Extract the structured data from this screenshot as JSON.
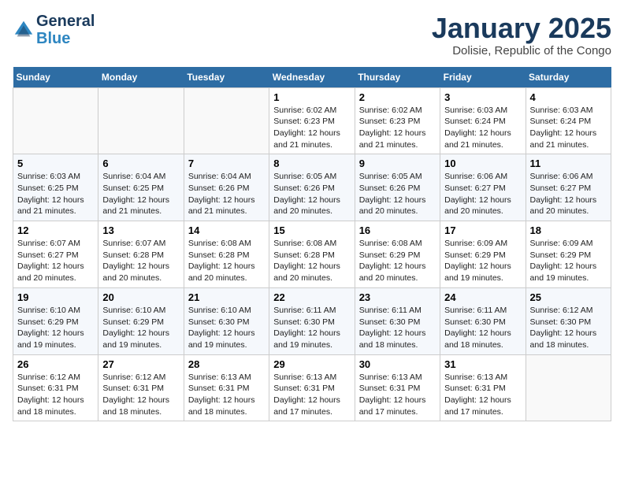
{
  "logo": {
    "line1": "General",
    "line2": "Blue"
  },
  "title": "January 2025",
  "location": "Dolisie, Republic of the Congo",
  "weekdays": [
    "Sunday",
    "Monday",
    "Tuesday",
    "Wednesday",
    "Thursday",
    "Friday",
    "Saturday"
  ],
  "weeks": [
    [
      {
        "day": "",
        "info": ""
      },
      {
        "day": "",
        "info": ""
      },
      {
        "day": "",
        "info": ""
      },
      {
        "day": "1",
        "info": "Sunrise: 6:02 AM\nSunset: 6:23 PM\nDaylight: 12 hours\nand 21 minutes."
      },
      {
        "day": "2",
        "info": "Sunrise: 6:02 AM\nSunset: 6:23 PM\nDaylight: 12 hours\nand 21 minutes."
      },
      {
        "day": "3",
        "info": "Sunrise: 6:03 AM\nSunset: 6:24 PM\nDaylight: 12 hours\nand 21 minutes."
      },
      {
        "day": "4",
        "info": "Sunrise: 6:03 AM\nSunset: 6:24 PM\nDaylight: 12 hours\nand 21 minutes."
      }
    ],
    [
      {
        "day": "5",
        "info": "Sunrise: 6:03 AM\nSunset: 6:25 PM\nDaylight: 12 hours\nand 21 minutes."
      },
      {
        "day": "6",
        "info": "Sunrise: 6:04 AM\nSunset: 6:25 PM\nDaylight: 12 hours\nand 21 minutes."
      },
      {
        "day": "7",
        "info": "Sunrise: 6:04 AM\nSunset: 6:26 PM\nDaylight: 12 hours\nand 21 minutes."
      },
      {
        "day": "8",
        "info": "Sunrise: 6:05 AM\nSunset: 6:26 PM\nDaylight: 12 hours\nand 20 minutes."
      },
      {
        "day": "9",
        "info": "Sunrise: 6:05 AM\nSunset: 6:26 PM\nDaylight: 12 hours\nand 20 minutes."
      },
      {
        "day": "10",
        "info": "Sunrise: 6:06 AM\nSunset: 6:27 PM\nDaylight: 12 hours\nand 20 minutes."
      },
      {
        "day": "11",
        "info": "Sunrise: 6:06 AM\nSunset: 6:27 PM\nDaylight: 12 hours\nand 20 minutes."
      }
    ],
    [
      {
        "day": "12",
        "info": "Sunrise: 6:07 AM\nSunset: 6:27 PM\nDaylight: 12 hours\nand 20 minutes."
      },
      {
        "day": "13",
        "info": "Sunrise: 6:07 AM\nSunset: 6:28 PM\nDaylight: 12 hours\nand 20 minutes."
      },
      {
        "day": "14",
        "info": "Sunrise: 6:08 AM\nSunset: 6:28 PM\nDaylight: 12 hours\nand 20 minutes."
      },
      {
        "day": "15",
        "info": "Sunrise: 6:08 AM\nSunset: 6:28 PM\nDaylight: 12 hours\nand 20 minutes."
      },
      {
        "day": "16",
        "info": "Sunrise: 6:08 AM\nSunset: 6:29 PM\nDaylight: 12 hours\nand 20 minutes."
      },
      {
        "day": "17",
        "info": "Sunrise: 6:09 AM\nSunset: 6:29 PM\nDaylight: 12 hours\nand 19 minutes."
      },
      {
        "day": "18",
        "info": "Sunrise: 6:09 AM\nSunset: 6:29 PM\nDaylight: 12 hours\nand 19 minutes."
      }
    ],
    [
      {
        "day": "19",
        "info": "Sunrise: 6:10 AM\nSunset: 6:29 PM\nDaylight: 12 hours\nand 19 minutes."
      },
      {
        "day": "20",
        "info": "Sunrise: 6:10 AM\nSunset: 6:29 PM\nDaylight: 12 hours\nand 19 minutes."
      },
      {
        "day": "21",
        "info": "Sunrise: 6:10 AM\nSunset: 6:30 PM\nDaylight: 12 hours\nand 19 minutes."
      },
      {
        "day": "22",
        "info": "Sunrise: 6:11 AM\nSunset: 6:30 PM\nDaylight: 12 hours\nand 19 minutes."
      },
      {
        "day": "23",
        "info": "Sunrise: 6:11 AM\nSunset: 6:30 PM\nDaylight: 12 hours\nand 18 minutes."
      },
      {
        "day": "24",
        "info": "Sunrise: 6:11 AM\nSunset: 6:30 PM\nDaylight: 12 hours\nand 18 minutes."
      },
      {
        "day": "25",
        "info": "Sunrise: 6:12 AM\nSunset: 6:30 PM\nDaylight: 12 hours\nand 18 minutes."
      }
    ],
    [
      {
        "day": "26",
        "info": "Sunrise: 6:12 AM\nSunset: 6:31 PM\nDaylight: 12 hours\nand 18 minutes."
      },
      {
        "day": "27",
        "info": "Sunrise: 6:12 AM\nSunset: 6:31 PM\nDaylight: 12 hours\nand 18 minutes."
      },
      {
        "day": "28",
        "info": "Sunrise: 6:13 AM\nSunset: 6:31 PM\nDaylight: 12 hours\nand 18 minutes."
      },
      {
        "day": "29",
        "info": "Sunrise: 6:13 AM\nSunset: 6:31 PM\nDaylight: 12 hours\nand 17 minutes."
      },
      {
        "day": "30",
        "info": "Sunrise: 6:13 AM\nSunset: 6:31 PM\nDaylight: 12 hours\nand 17 minutes."
      },
      {
        "day": "31",
        "info": "Sunrise: 6:13 AM\nSunset: 6:31 PM\nDaylight: 12 hours\nand 17 minutes."
      },
      {
        "day": "",
        "info": ""
      }
    ]
  ]
}
